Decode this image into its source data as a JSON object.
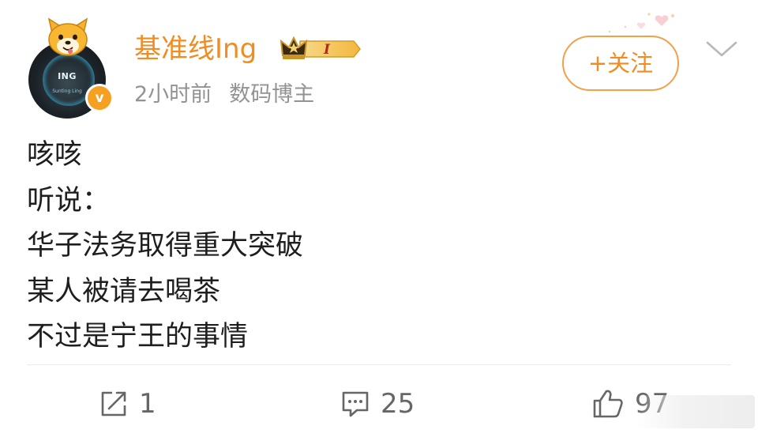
{
  "post": {
    "author": {
      "name": "基准线Ing",
      "avatar_logo": "ING",
      "avatar_sub": "Sunting Ling",
      "verified_mark": "v",
      "badge_level": "I"
    },
    "time": "2小时前",
    "source": "数码博主",
    "follow_label": "+关注",
    "content_lines": [
      "咳咳",
      "听说：",
      "华子法务取得重大突破",
      "某人被请去喝茶",
      "不过是宁王的事情"
    ],
    "actions": {
      "repost_count": "1",
      "comment_count": "25",
      "like_count": "97"
    }
  },
  "colors": {
    "accent_orange": "#f08c22",
    "meta_gray": "#939393",
    "verified_badge": "#f6a021",
    "icon_gray": "#666666"
  },
  "icons": {
    "repost": "repost-icon",
    "comment": "comment-icon",
    "like": "thumbs-up-icon",
    "menu": "chevron-down-icon",
    "crown": "crown-icon"
  }
}
